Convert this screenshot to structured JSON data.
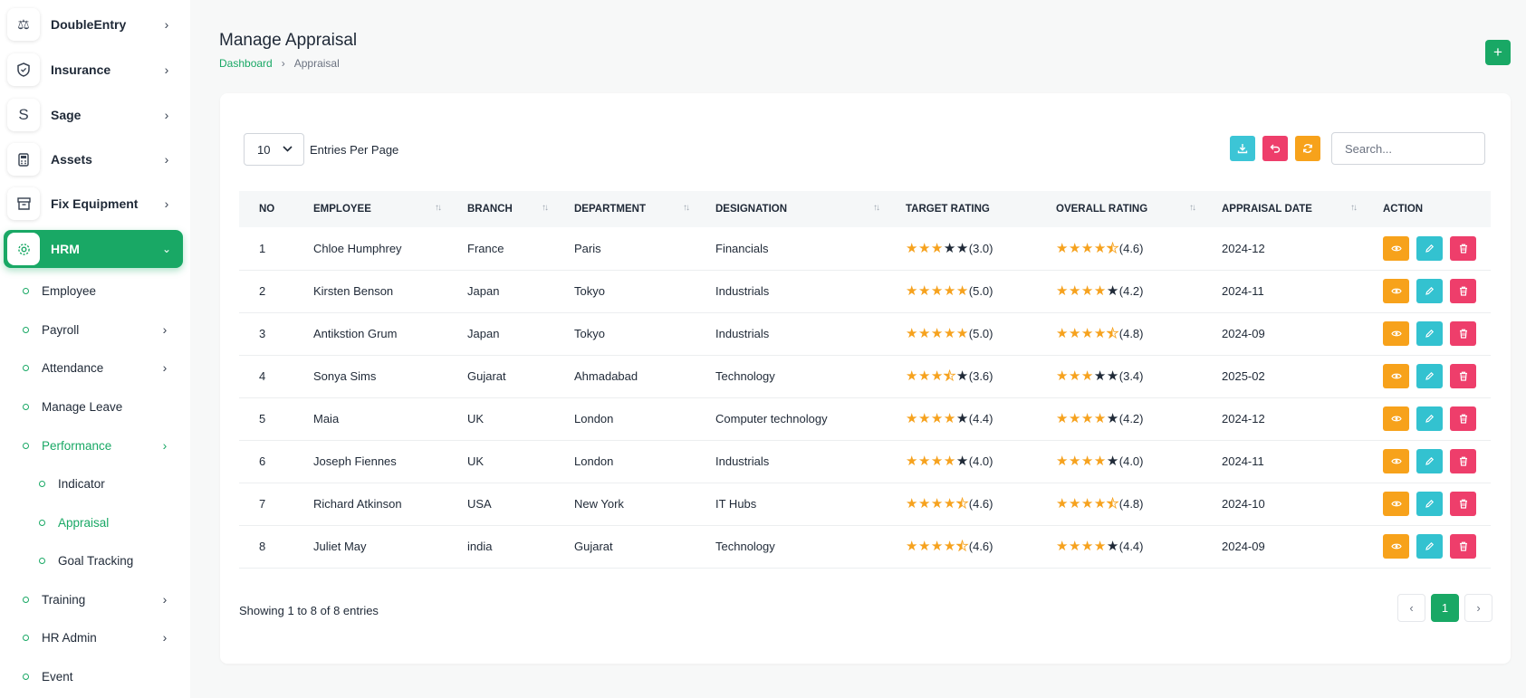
{
  "sidebar": {
    "top_items": [
      {
        "label": "DoubleEntry",
        "icon": "scale-icon"
      },
      {
        "label": "Insurance",
        "icon": "shield-icon"
      },
      {
        "label": "Sage",
        "icon": "letter-s-icon"
      },
      {
        "label": "Assets",
        "icon": "calculator-icon"
      },
      {
        "label": "Fix Equipment",
        "icon": "archive-box-icon"
      }
    ],
    "hrm": {
      "label": "HRM",
      "icon": "hrm-gear-icon"
    },
    "hrm_children": [
      {
        "label": "Employee",
        "has_children": false
      },
      {
        "label": "Payroll",
        "has_children": true
      },
      {
        "label": "Attendance",
        "has_children": true
      },
      {
        "label": "Manage Leave",
        "has_children": false
      },
      {
        "label": "Performance",
        "has_children": true
      },
      {
        "label": "Indicator"
      },
      {
        "label": "Appraisal"
      },
      {
        "label": "Goal Tracking"
      },
      {
        "label": "Training",
        "has_children": true
      },
      {
        "label": "HR Admin",
        "has_children": true
      },
      {
        "label": "Event",
        "has_children": false
      }
    ]
  },
  "header": {
    "title": "Manage Appraisal",
    "breadcrumb": {
      "home": "Dashboard",
      "current": "Appraisal"
    },
    "add_label": "+"
  },
  "toolbar": {
    "entries_value": "10",
    "entries_label": "Entries Per Page",
    "search_placeholder": "Search..."
  },
  "table": {
    "columns": [
      "NO",
      "EMPLOYEE",
      "BRANCH",
      "DEPARTMENT",
      "DESIGNATION",
      "TARGET RATING",
      "OVERALL RATING",
      "APPRAISAL DATE",
      "ACTION"
    ],
    "rows": [
      {
        "no": "1",
        "employee": "Chloe Humphrey",
        "branch": "France",
        "department": "Paris",
        "designation": "Financials",
        "target": 3.0,
        "target_label": "(3.0)",
        "overall": 4.6,
        "overall_label": "(4.6)",
        "date": "2024-12"
      },
      {
        "no": "2",
        "employee": "Kirsten Benson",
        "branch": "Japan",
        "department": "Tokyo",
        "designation": "Industrials",
        "target": 5.0,
        "target_label": "(5.0)",
        "overall": 4.2,
        "overall_label": "(4.2)",
        "date": "2024-11"
      },
      {
        "no": "3",
        "employee": "Antikstion Grum",
        "branch": "Japan",
        "department": "Tokyo",
        "designation": "Industrials",
        "target": 5.0,
        "target_label": "(5.0)",
        "overall": 4.8,
        "overall_label": "(4.8)",
        "date": "2024-09"
      },
      {
        "no": "4",
        "employee": "Sonya Sims",
        "branch": "Gujarat",
        "department": "Ahmadabad",
        "designation": "Technology",
        "target": 3.6,
        "target_label": "(3.6)",
        "overall": 3.4,
        "overall_label": "(3.4)",
        "date": "2025-02"
      },
      {
        "no": "5",
        "employee": "Maia",
        "branch": "UK",
        "department": "London",
        "designation": "Computer technology",
        "target": 4.4,
        "target_label": "(4.4)",
        "overall": 4.2,
        "overall_label": "(4.2)",
        "date": "2024-12"
      },
      {
        "no": "6",
        "employee": "Joseph Fiennes",
        "branch": "UK",
        "department": "London",
        "designation": "Industrials",
        "target": 4.0,
        "target_label": "(4.0)",
        "overall": 4.0,
        "overall_label": "(4.0)",
        "date": "2024-11"
      },
      {
        "no": "7",
        "employee": "Richard Atkinson",
        "branch": "USA",
        "department": "New York",
        "designation": "IT Hubs",
        "target": 4.6,
        "target_label": "(4.6)",
        "overall": 4.8,
        "overall_label": "(4.8)",
        "date": "2024-10"
      },
      {
        "no": "8",
        "employee": "Juliet May",
        "branch": "india",
        "department": "Gujarat",
        "designation": "Technology",
        "target": 4.6,
        "target_label": "(4.6)",
        "overall": 4.4,
        "overall_label": "(4.4)",
        "date": "2024-09"
      }
    ]
  },
  "footer": {
    "showing": "Showing 1 to 8 of 8 entries",
    "current_page": "1",
    "prev": "‹",
    "next": "›"
  },
  "colors": {
    "brand": "#19a865",
    "view": "#f7a21b",
    "edit": "#33c2d0",
    "delete": "#ee3e6b",
    "download": "#3cc5d6",
    "reset": "#ee3e6b",
    "refresh": "#f7a21b",
    "star": "#f6a21e"
  }
}
